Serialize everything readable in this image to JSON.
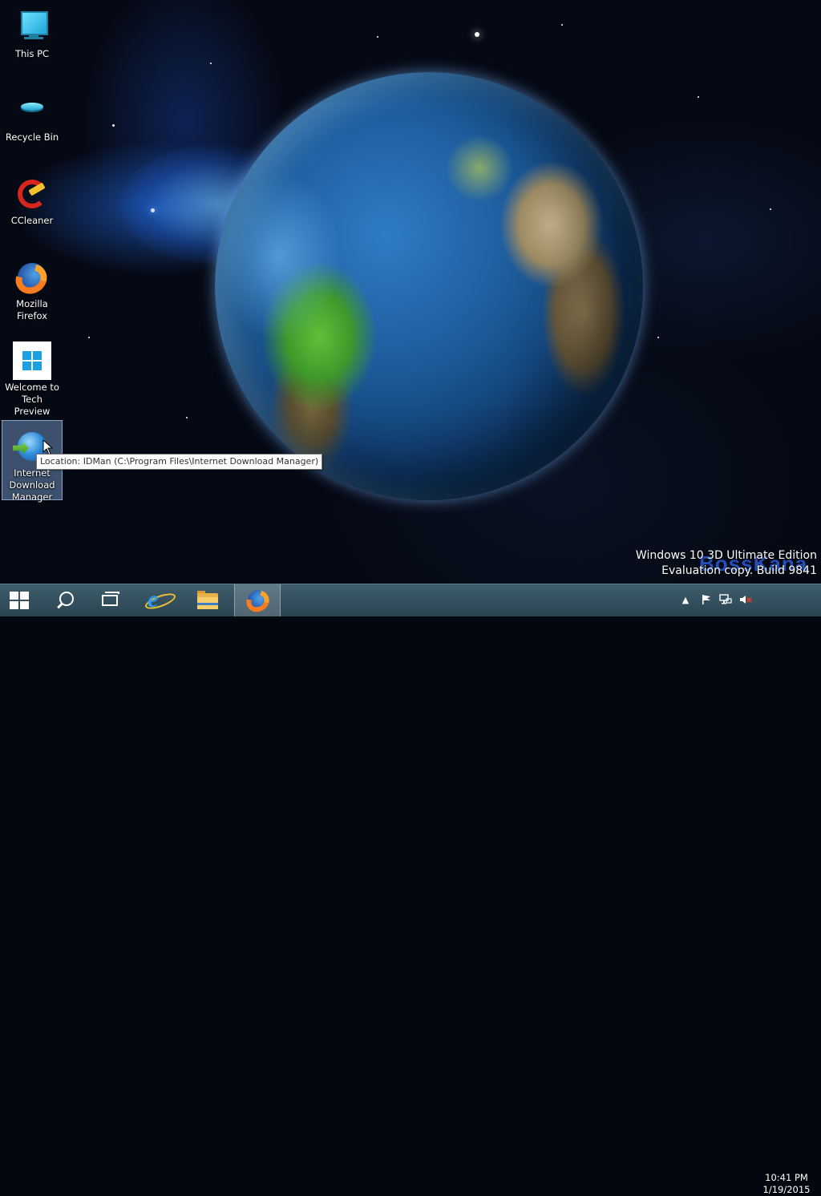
{
  "desktop_icons": [
    {
      "label": "This PC"
    },
    {
      "label": "Recycle Bin"
    },
    {
      "label": "CCleaner"
    },
    {
      "label": "Mozilla Firefox"
    },
    {
      "label": "Welcome to Tech Preview"
    },
    {
      "label": "Internet Download Manager"
    }
  ],
  "tooltip": {
    "text": "Location: IDMan (C:\\Program Files\\Internet Download Manager)"
  },
  "watermark": {
    "line1": "Windows 10 3D Ultimate Edition",
    "line2": "Evaluation copy. Build 9841",
    "brand": "BossKana"
  },
  "taskbar": {
    "pinned": [
      {
        "name": "start-icon"
      },
      {
        "name": "search-icon"
      },
      {
        "name": "task-view-icon"
      },
      {
        "name": "internet-explorer-icon"
      },
      {
        "name": "file-explorer-icon"
      },
      {
        "name": "firefox-icon",
        "active": true
      }
    ]
  },
  "tray": {
    "icons": [
      "show-hidden-icons-chevron",
      "action-center-flag-icon",
      "network-icon",
      "volume-muted-icon"
    ],
    "time": "10:41 PM",
    "date": "1/19/2015"
  },
  "colors": {
    "taskbar": "#2f4a58",
    "selection": "#82aadc",
    "brand_text": "#2a5bd6"
  }
}
